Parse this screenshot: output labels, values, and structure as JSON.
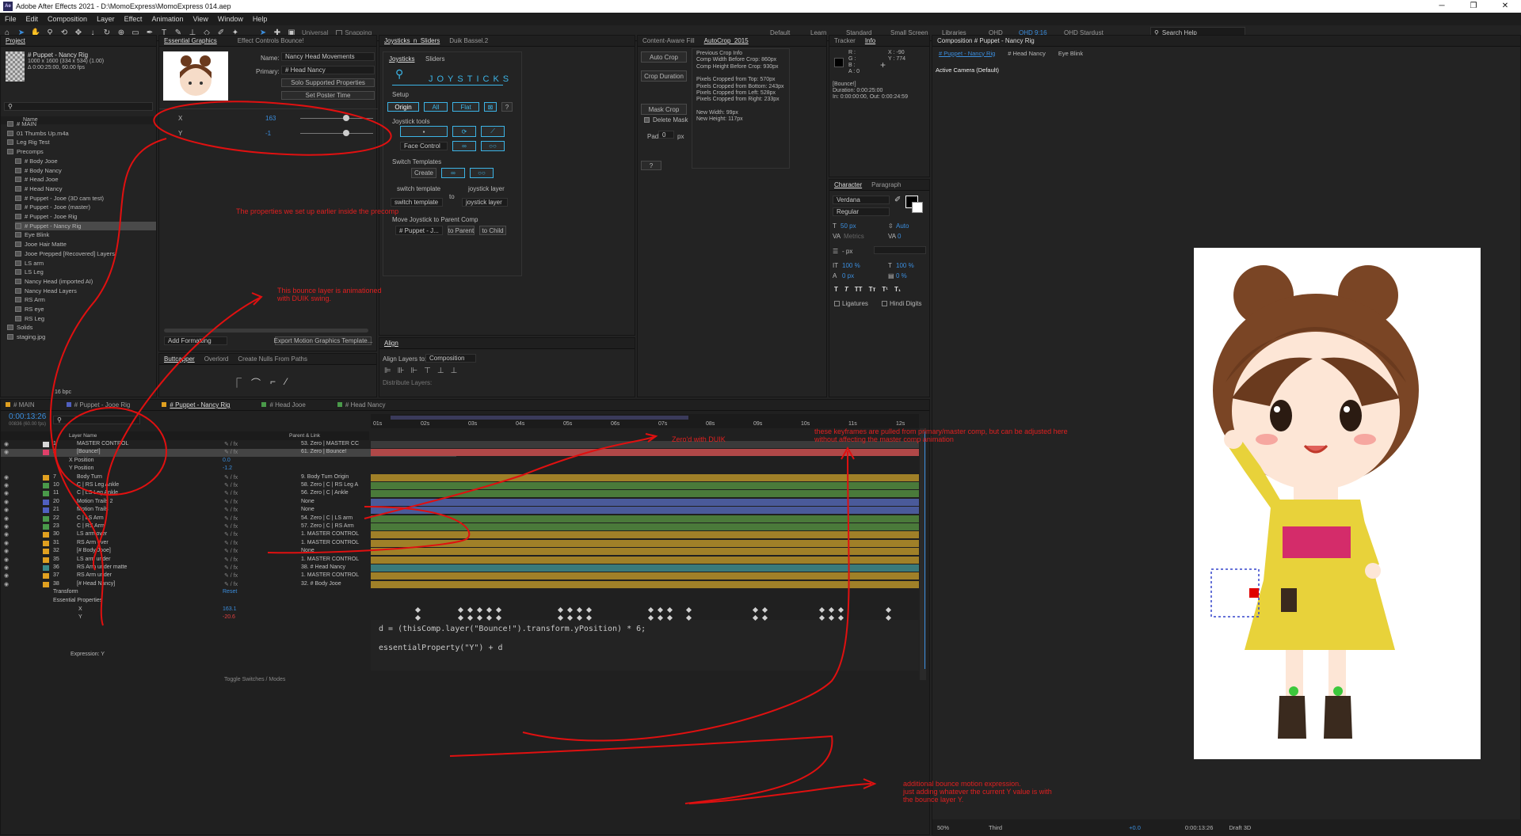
{
  "window_title": "Adobe After Effects 2021 - D:\\MomoExpress\\MomoExpress 014.aep",
  "menu": [
    "File",
    "Edit",
    "Composition",
    "Layer",
    "Effect",
    "Animation",
    "View",
    "Window",
    "Help"
  ],
  "toolbar": {
    "universal": "Universal",
    "snapping": "Snapping"
  },
  "workspaces": [
    "Default",
    "Learn",
    "Standard",
    "Small Screen",
    "Libraries",
    "QHD",
    "QHD 9:16",
    "QHD Stardust"
  ],
  "search_help": "Search Help",
  "project": {
    "tab": "Project",
    "comp_name": "# Puppet - Nancy Rig",
    "comp_size": "1000 x 1600  (334 x 534) (1.00)",
    "comp_dur": "Δ 0:00:25:00, 60.00 fps",
    "col_name": "Name",
    "items": [
      "# MAIN",
      "01 Thumbs Up.m4a",
      "Leg Rig Test",
      "Precomps",
      "# Body Jooe",
      "# Body Nancy",
      "# Head Jooe",
      "# Head Nancy",
      "# Puppet - Jooe (3D cam test)",
      "# Puppet - Jooe (master)",
      "# Puppet - Jooe Rig",
      "# Puppet - Nancy Rig",
      "Eye Blink",
      "Jooe Hair Matte",
      "Jooe Prepped [Recovered] Layers",
      "LS arm",
      "LS Leg",
      "Nancy Head (imported AI)",
      "Nancy Head Layers",
      "RS Arm",
      "RS eye",
      "RS Leg",
      "Solids",
      "staging.jpg"
    ],
    "bpc": "16 bpc"
  },
  "essential": {
    "tab": "Essential Graphics",
    "tab2": "Effect Controls Bounce!",
    "name_label": "Name:",
    "name_value": "Nancy Head Movements",
    "primary_label": "Primary:",
    "primary_value": "# Head Nancy",
    "solo_btn": "Solo Supported Properties",
    "poster_btn": "Set Poster Time",
    "x_label": "X",
    "x_value": "163",
    "y_label": "Y",
    "y_value": "-1",
    "add_formatting": "Add Formatting",
    "export_btn": "Export Motion Graphics Template..."
  },
  "buttcapper": {
    "tabs": [
      "Buttcapper",
      "Overlord",
      "Create Nulls From Paths"
    ]
  },
  "joysticks": {
    "tab": "Joysticks_n_Sliders",
    "tab2": "Duik Bassel.2",
    "subtabs": [
      "Joysticks",
      "Sliders"
    ],
    "logo": "JOYSTICKS",
    "setup": "Setup",
    "origin": "Origin",
    "all": "All",
    "flat": "Flat",
    "q": "?",
    "tools": "Joystick tools",
    "face_control": "Face Control",
    "switch_templates": "Switch Templates",
    "create": "Create",
    "switch_template_label": "switch template",
    "joystick_layer_label": "joystick layer",
    "to": "to",
    "switch_template_sel": "switch template",
    "joystick_layer_sel": "joystick layer",
    "move_parent": "Move Joystick to Parent Comp",
    "puppet_sel": "# Puppet - J...",
    "to_parent": "to Parent",
    "to_child": "to Child"
  },
  "align": {
    "tab": "Align",
    "layers_to": "Align Layers to:",
    "layers_to_val": "Composition",
    "distribute": "Distribute Layers:"
  },
  "autocrop": {
    "tab": "Content-Aware Fill",
    "tab2": "AutoCrop_2015",
    "auto_crop": "Auto Crop",
    "crop_duration": "Crop Duration",
    "mask_crop": "Mask Crop",
    "delete_mask": "Delete Mask",
    "pad": "Pad:",
    "pad_val": "0",
    "px": "px",
    "q": "?",
    "info": [
      "Previous Crop Info",
      "Comp Width Before Crop: 860px",
      "Comp Height Before Crop: 930px",
      "",
      "Pixels Cropped from Top: 570px",
      "Pixels Cropped from Bottom: 243px",
      "Pixels Cropped from Left: 528px",
      "Pixels Cropped from Right: 233px",
      "",
      "New Width: 99px",
      "New Height: 117px"
    ]
  },
  "info": {
    "tabs": [
      "Tracker",
      "Info"
    ],
    "rgb": [
      "R :",
      "G :",
      "B :",
      "A :  0"
    ],
    "x": "X : -90",
    "y": "Y : 774",
    "layer": "[Bounce!]",
    "duration": "Duration: 0:00:25:00",
    "inout": "In: 0:00:00:00, Out: 0:00:24:59"
  },
  "character": {
    "tabs": [
      "Character",
      "Paragraph"
    ],
    "font": "Verdana",
    "style": "Regular",
    "size": "50 px",
    "leading": "Auto",
    "kerning": "Metrics",
    "tracking": "0",
    "stroke": "- px",
    "vscale": "100 %",
    "hscale": "100 %",
    "baseline": "0 px",
    "tsume": "0 %",
    "ligatures": "Ligatures",
    "hindi": "Hindi Digits",
    "styles": [
      "T",
      "T",
      "TT",
      "Tт",
      "T¹",
      "T₁"
    ]
  },
  "composition": {
    "tab": "Composition # Puppet - Nancy Rig",
    "crumbs": [
      "# Puppet - Nancy Rig",
      "# Head Nancy",
      "Eye Blink"
    ],
    "camera": "Active Camera (Default)",
    "zoom": "50%",
    "view": "Third",
    "time": "0:00:13:26",
    "renderer": "Draft 3D",
    "exposure": "+0.0"
  },
  "timeline": {
    "tabs": [
      "# MAIN",
      "# Puppet - Jooe Rig",
      "# Puppet - Nancy Rig",
      "# Head Jooe",
      "# Head Nancy"
    ],
    "time": "0:00:13:26",
    "frames": "00836 (60.00 fps)",
    "col_layer": "Layer Name",
    "col_parent": "Parent & Link",
    "ruler": [
      "01s",
      "02s",
      "03s",
      "04s",
      "05s",
      "06s",
      "07s",
      "08s",
      "09s",
      "10s",
      "11s",
      "12s"
    ],
    "layers": [
      {
        "num": "1",
        "name": "MASTER CONTROL",
        "parent": "53. Zero | MASTER CC",
        "color": "#d8d8d8"
      },
      {
        "num": "2",
        "name": "[Bounce!]",
        "parent": "61. Zero | Bounce!",
        "color": "#e0406a"
      },
      {
        "num": "",
        "name": "X Position",
        "parent": "",
        "color": ""
      },
      {
        "num": "",
        "name": "Y Position",
        "parent": "",
        "color": ""
      },
      {
        "num": "7",
        "name": "Body Turn",
        "parent": "9. Body Turn Origin",
        "color": "#e0a020"
      },
      {
        "num": "10",
        "name": "C | RS Leg Ankle",
        "parent": "58. Zero | C | RS Leg A",
        "color": "#4a9a4a"
      },
      {
        "num": "11",
        "name": "C | LS Leg Ankle",
        "parent": "56. Zero | C | Ankle",
        "color": "#4a9a4a"
      },
      {
        "num": "20",
        "name": "Motion Trails 2",
        "parent": "None",
        "color": "#5060c0"
      },
      {
        "num": "21",
        "name": "Motion Trails",
        "parent": "None",
        "color": "#5060c0"
      },
      {
        "num": "22",
        "name": "C | LS Arm",
        "parent": "54. Zero | C | LS arm",
        "color": "#4a9a4a"
      },
      {
        "num": "23",
        "name": "C | RS Arm",
        "parent": "57. Zero | C | RS Arm",
        "color": "#4a9a4a"
      },
      {
        "num": "30",
        "name": "LS arm over",
        "parent": "1. MASTER CONTROL",
        "color": "#e0a020"
      },
      {
        "num": "31",
        "name": "RS Arm over",
        "parent": "1. MASTER CONTROL",
        "color": "#e0a020"
      },
      {
        "num": "32",
        "name": "[# Body Jooe]",
        "parent": "None",
        "color": "#e0a020"
      },
      {
        "num": "35",
        "name": "LS arm under",
        "parent": "1. MASTER CONTROL",
        "color": "#e0a020"
      },
      {
        "num": "36",
        "name": "RS Arm under matte",
        "parent": "38. # Head Nancy",
        "color": "#3a8a8a"
      },
      {
        "num": "37",
        "name": "RS Arm under",
        "parent": "1. MASTER CONTROL",
        "color": "#e0a020"
      },
      {
        "num": "38",
        "name": "[# Head Nancy]",
        "parent": "32. # Body Jooe",
        "color": "#e0a020"
      }
    ],
    "x_pos": "0.0",
    "y_pos": "-1.2",
    "transform": "Transform",
    "reset": "Reset",
    "essential_props": "Essential Properties",
    "prop_x": "X",
    "prop_y": "Y",
    "prop_x_val": "163.1",
    "prop_y_val": "-20.6",
    "expression_label": "Expression: Y",
    "expr_line1": "d = (thisComp.layer(\"Bounce!\").transform.yPosition) * 6;",
    "expr_line2": "essentialProperty(\"Y\") + d",
    "toggle": "Toggle Switches / Modes"
  },
  "annotations": {
    "a1": "The properties we set up earlier inside the precomp",
    "a2": "This bounce layer is animationed\nwith DUIK swing.",
    "a3": "Zero'd with DUIK",
    "a4": "these keyframes are pulled from primary/master comp, but can be adjusted here\nwithout affecting the master comp animation",
    "a5": "additional bounce motion expression.\njust adding whatever the current Y value is with\nthe bounce layer Y."
  }
}
